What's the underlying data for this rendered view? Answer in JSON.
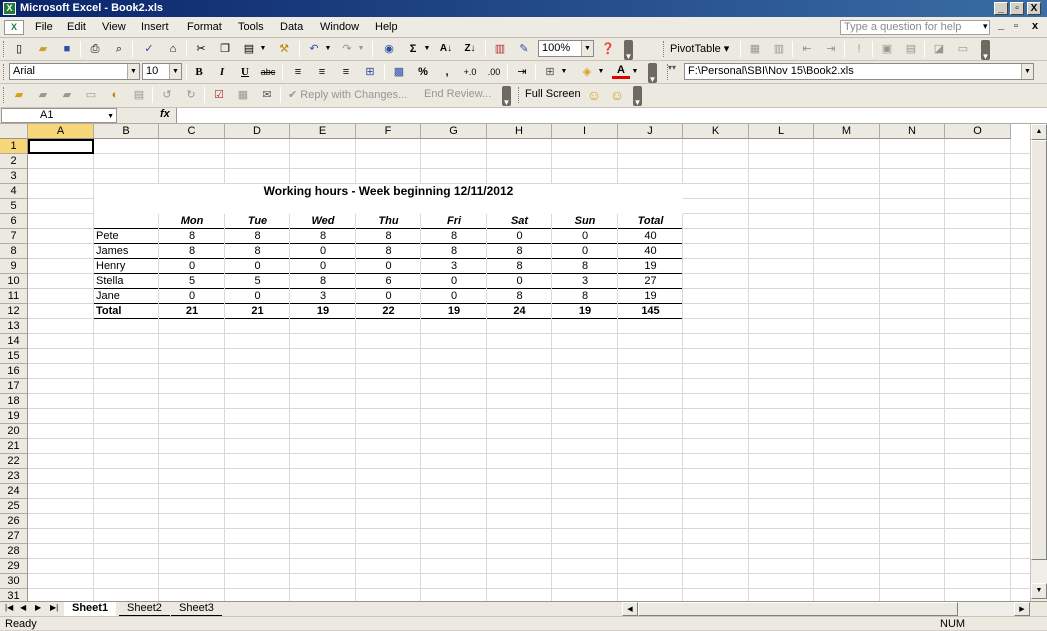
{
  "window": {
    "title": "Microsoft Excel - Book2.xls",
    "app_icon": "excel-icon",
    "controls": [
      "_",
      "▫",
      "X"
    ]
  },
  "menubar": {
    "items": [
      "File",
      "Edit",
      "View",
      "Insert",
      "Format",
      "Tools",
      "Data",
      "Window",
      "Help"
    ],
    "ask_placeholder": "Type a question for help",
    "doc_controls": [
      "▾",
      "_",
      "▫",
      "x"
    ]
  },
  "toolbar": {
    "zoom": "100%",
    "pivot_label": "PivotTable ▾",
    "font_name": "Arial",
    "font_size": "10",
    "path": "F:\\Personal\\SBI\\Nov 15\\Book2.xls",
    "reply_label": "Reply with Changes...",
    "end_review_label": "End Review...",
    "full_screen_label": "Full Screen"
  },
  "formula_bar": {
    "name_box": "A1",
    "fx_label": "fx",
    "content": ""
  },
  "sheet": {
    "columns": [
      "A",
      "B",
      "C",
      "D",
      "E",
      "F",
      "G",
      "H",
      "I",
      "J",
      "K",
      "L",
      "M",
      "N",
      "O"
    ],
    "rows": [
      "1",
      "2",
      "3",
      "4",
      "5",
      "6",
      "7",
      "8",
      "9",
      "10",
      "11",
      "12",
      "13",
      "14",
      "15",
      "16",
      "17",
      "18",
      "19",
      "20",
      "21",
      "22",
      "23",
      "24",
      "25",
      "26",
      "27",
      "28",
      "29",
      "30",
      "31"
    ],
    "title": "Working hours - Week beginning 12/11/2012",
    "headers": [
      "Mon",
      "Tue",
      "Wed",
      "Thu",
      "Fri",
      "Sat",
      "Sun",
      "Total"
    ],
    "data_rows": [
      {
        "name": "Pete",
        "values": [
          "8",
          "8",
          "8",
          "8",
          "8",
          "0",
          "0",
          "40"
        ]
      },
      {
        "name": "James",
        "values": [
          "8",
          "8",
          "0",
          "8",
          "8",
          "8",
          "0",
          "40"
        ]
      },
      {
        "name": "Henry",
        "values": [
          "0",
          "0",
          "0",
          "0",
          "3",
          "8",
          "8",
          "19"
        ]
      },
      {
        "name": "Stella",
        "values": [
          "5",
          "5",
          "8",
          "6",
          "0",
          "0",
          "3",
          "27"
        ]
      },
      {
        "name": "Jane",
        "values": [
          "0",
          "0",
          "3",
          "0",
          "0",
          "8",
          "8",
          "19"
        ]
      }
    ],
    "total_row": {
      "name": "Total",
      "values": [
        "21",
        "21",
        "19",
        "22",
        "19",
        "24",
        "19",
        "145"
      ]
    }
  },
  "sheet_tabs": [
    "Sheet1",
    "Sheet2",
    "Sheet3"
  ],
  "statusbar": {
    "status": "Ready",
    "num": "NUM"
  }
}
